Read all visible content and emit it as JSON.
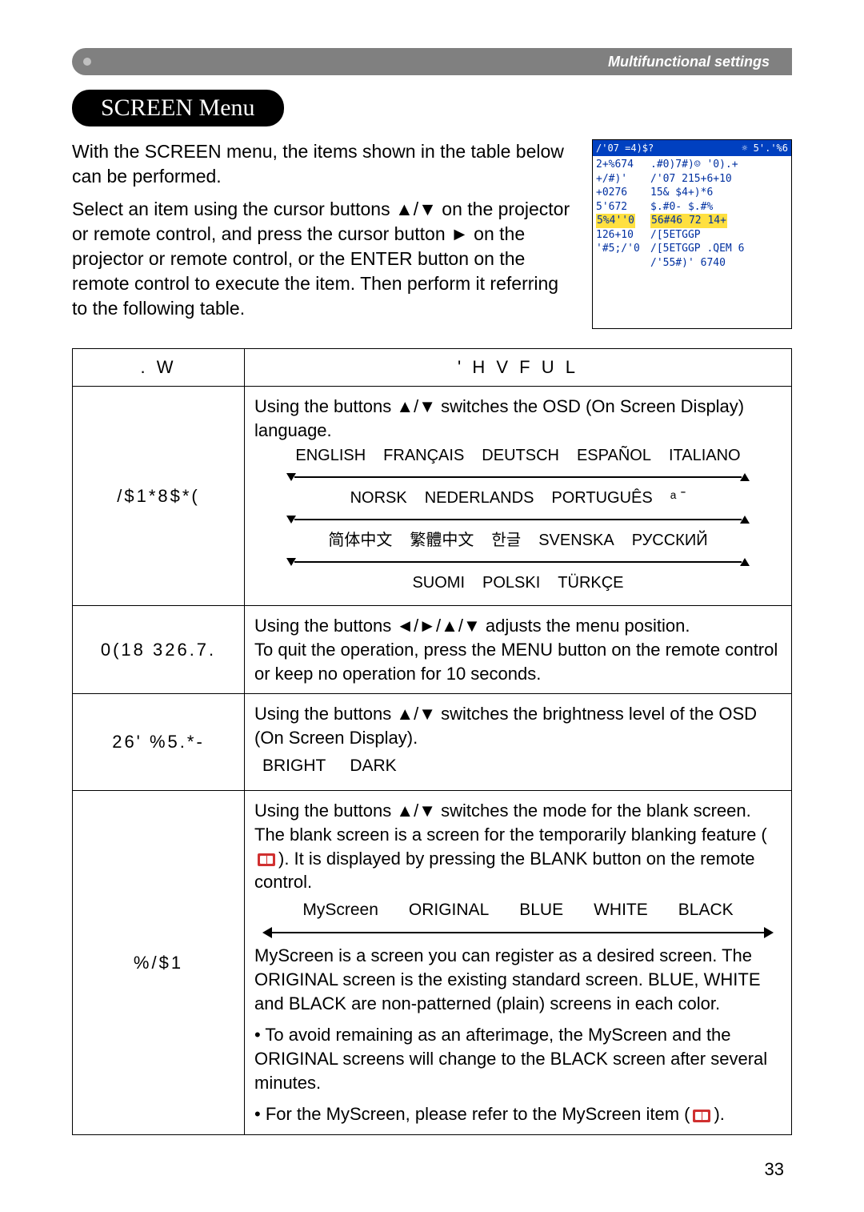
{
  "header": {
    "section": "Multifunctional settings"
  },
  "title": "SCREEN Menu",
  "intro": {
    "p1": "With the SCREEN menu, the items shown in the table below can be performed.",
    "p2": "Select an item using the cursor buttons ▲/▼ on the projector or remote control, and press the cursor button ► on the projector or remote control, or the ENTER button on the remote control to execute the item. Then perform it referring to the following table."
  },
  "osd": {
    "title_left": "/'07 =4)$?",
    "title_right": "☼ 5'.'%6",
    "rows": [
      [
        "2+%674",
        ".#0)7#)☺   '0).+"
      ],
      [
        "+/#)'",
        "/'07 215+6+10"
      ],
      [
        "+0276",
        "15& $4+)*6"
      ],
      [
        "5'672",
        "$.#0-       $.#%"
      ],
      [
        "5%4''0",
        "56#46 72    14+"
      ],
      [
        "126+10",
        "/[5ETGGP"
      ],
      [
        "'#5;/'0",
        "/[5ETGGP .QEM 6"
      ],
      [
        "",
        "/'55#)'    6740"
      ]
    ],
    "highlight_row_index": 4
  },
  "columns": {
    "item": ". W",
    "desc": "' H V F U L"
  },
  "rows": {
    "language": {
      "item": "/$1*8$*(",
      "lead": "Using the buttons ▲/▼ switches the OSD (On Screen Display) language.",
      "langs_r1": [
        "ENGLISH",
        "FRANÇAIS",
        "DEUTSCH",
        "ESPAÑOL",
        "ITALIANO"
      ],
      "langs_r2": [
        "NORSK",
        "NEDERLANDS",
        "PORTUGUÊS",
        "ᵃ ˉ"
      ],
      "langs_r3": [
        "简体中文",
        "繁體中文",
        "한글",
        "SVENSKA",
        "РУССКИЙ"
      ],
      "langs_r4": [
        "SUOMI",
        "POLSKI",
        "TÜRKÇE"
      ]
    },
    "menupos": {
      "item": "0(18 326.7.",
      "desc": "Using the buttons ◄/►/▲/▼ adjusts the menu position.\nTo quit the operation, press the MENU button on the remote control or keep no operation for 10 seconds."
    },
    "osdbright": {
      "item": "26' %5.*-",
      "lead": "Using the buttons ▲/▼ switches the brightness level of the OSD (On Screen Display).",
      "opts": [
        "BRIGHT",
        "DARK"
      ]
    },
    "blank": {
      "item": "%/$1",
      "p1": "Using the buttons ▲/▼ switches the mode for the blank screen. The blank screen is a screen for the temporarily blanking feature (",
      "p1b": "). It is displayed by pressing the BLANK button on the remote control.",
      "opts": [
        "MyScreen",
        "ORIGINAL",
        "BLUE",
        "WHITE",
        "BLACK"
      ],
      "p2": "MyScreen is a screen you can register as a desired screen. The ORIGINAL screen is the existing standard screen. BLUE, WHITE and BLACK are non-patterned (plain) screens in each color.",
      "p3": "• To avoid remaining as an afterimage, the MyScreen and the ORIGINAL screens will change to the BLACK screen after several minutes.",
      "p4a": "• For the MyScreen, please refer to the MyScreen item (",
      "p4b": ")."
    }
  },
  "page_number": "33"
}
